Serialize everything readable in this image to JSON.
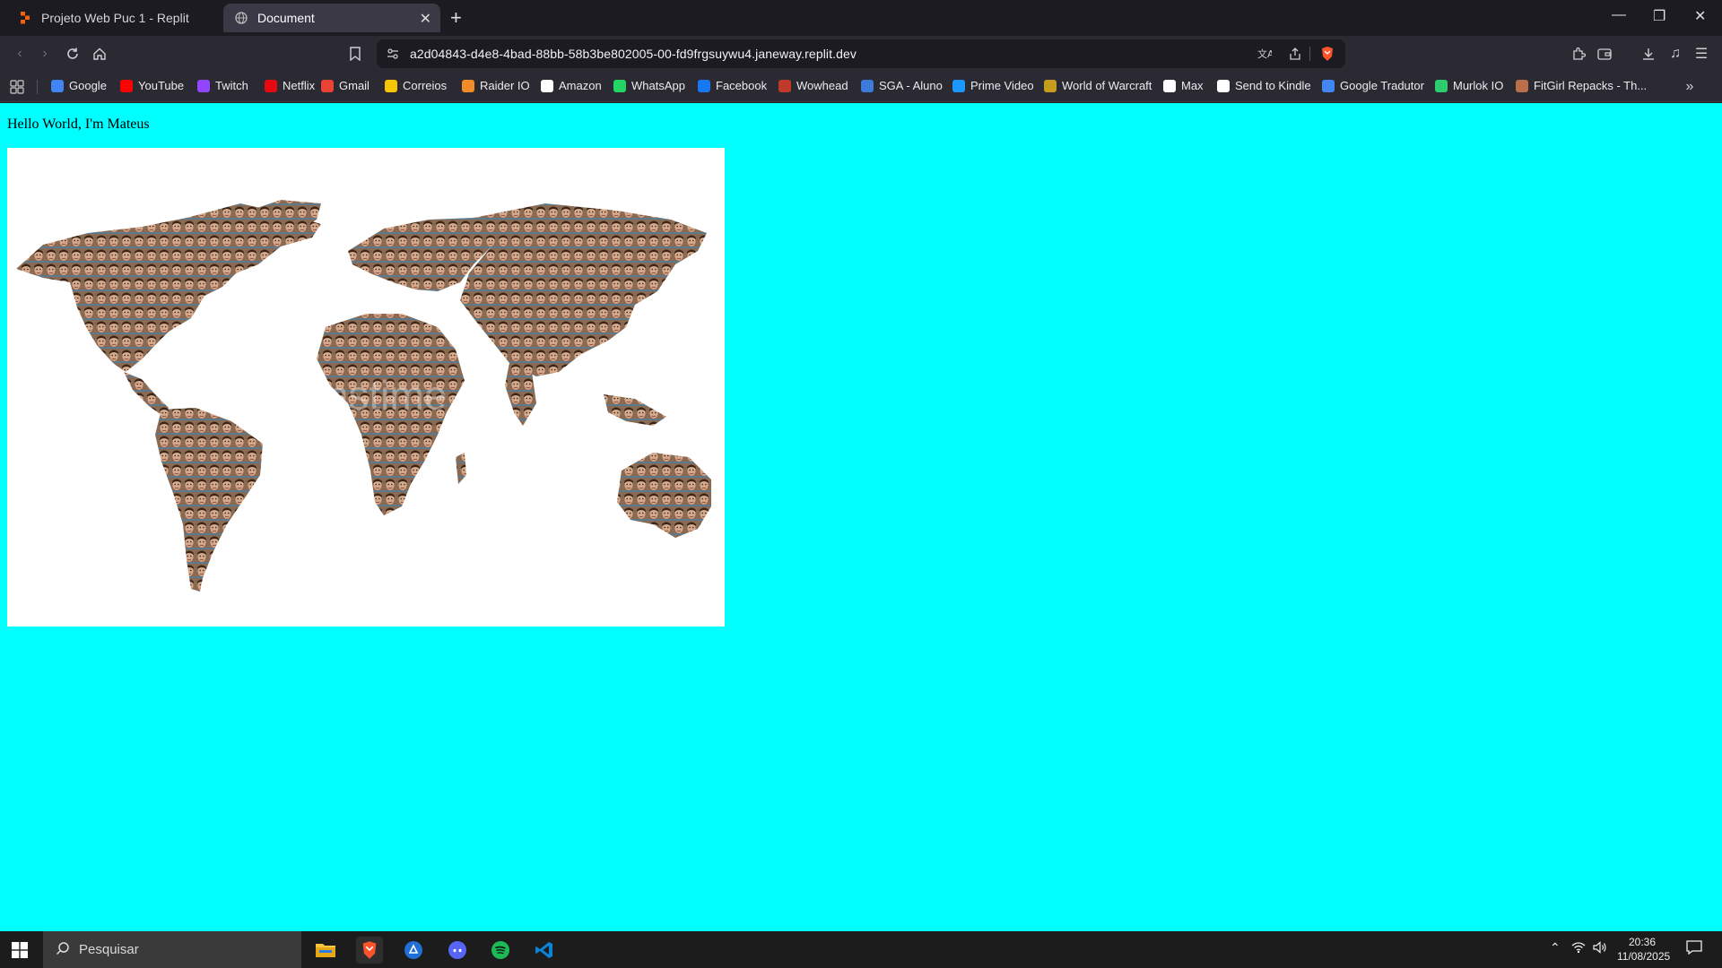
{
  "tabs": [
    {
      "title": "Projeto Web Puc 1 - Replit",
      "active": false
    },
    {
      "title": "Document",
      "active": true
    }
  ],
  "toolbar": {
    "url": "a2d04843-d4e8-4bad-88bb-58b3be802005-00-fd9frgsuywu4.janeway.replit.dev"
  },
  "bookmarks": [
    {
      "label": "Google",
      "color": "#4285f4"
    },
    {
      "label": "YouTube",
      "color": "#ff0000"
    },
    {
      "label": "Twitch",
      "color": "#9146ff"
    },
    {
      "label": "Netflix",
      "color": "#e50914"
    },
    {
      "label": "Gmail",
      "color": "#ea4335"
    },
    {
      "label": "Correios",
      "color": "#f7c600"
    },
    {
      "label": "Raider IO",
      "color": "#f28c28"
    },
    {
      "label": "Amazon",
      "color": "#ffffff"
    },
    {
      "label": "WhatsApp",
      "color": "#25d366"
    },
    {
      "label": "Facebook",
      "color": "#1877f2"
    },
    {
      "label": "Wowhead",
      "color": "#c0392b"
    },
    {
      "label": "SGA - Aluno",
      "color": "#3d7ad9"
    },
    {
      "label": "Prime Video",
      "color": "#1a98ff"
    },
    {
      "label": "World of Warcraft",
      "color": "#c79c1e"
    },
    {
      "label": "Max",
      "color": "#ffffff"
    },
    {
      "label": "Send to Kindle",
      "color": "#ffffff"
    },
    {
      "label": "Google Tradutor",
      "color": "#4285f4"
    },
    {
      "label": "Murlok IO",
      "color": "#2ecc71"
    },
    {
      "label": "FitGirl Repacks - Th...",
      "color": "#b86f4a"
    }
  ],
  "page": {
    "heading": "Hello World, I'm Mateus",
    "background": "#00ffff",
    "watermark": "dreamstime"
  },
  "taskbar": {
    "search_placeholder": "Pesquisar",
    "time": "20:36",
    "date": "11/08/2025"
  }
}
